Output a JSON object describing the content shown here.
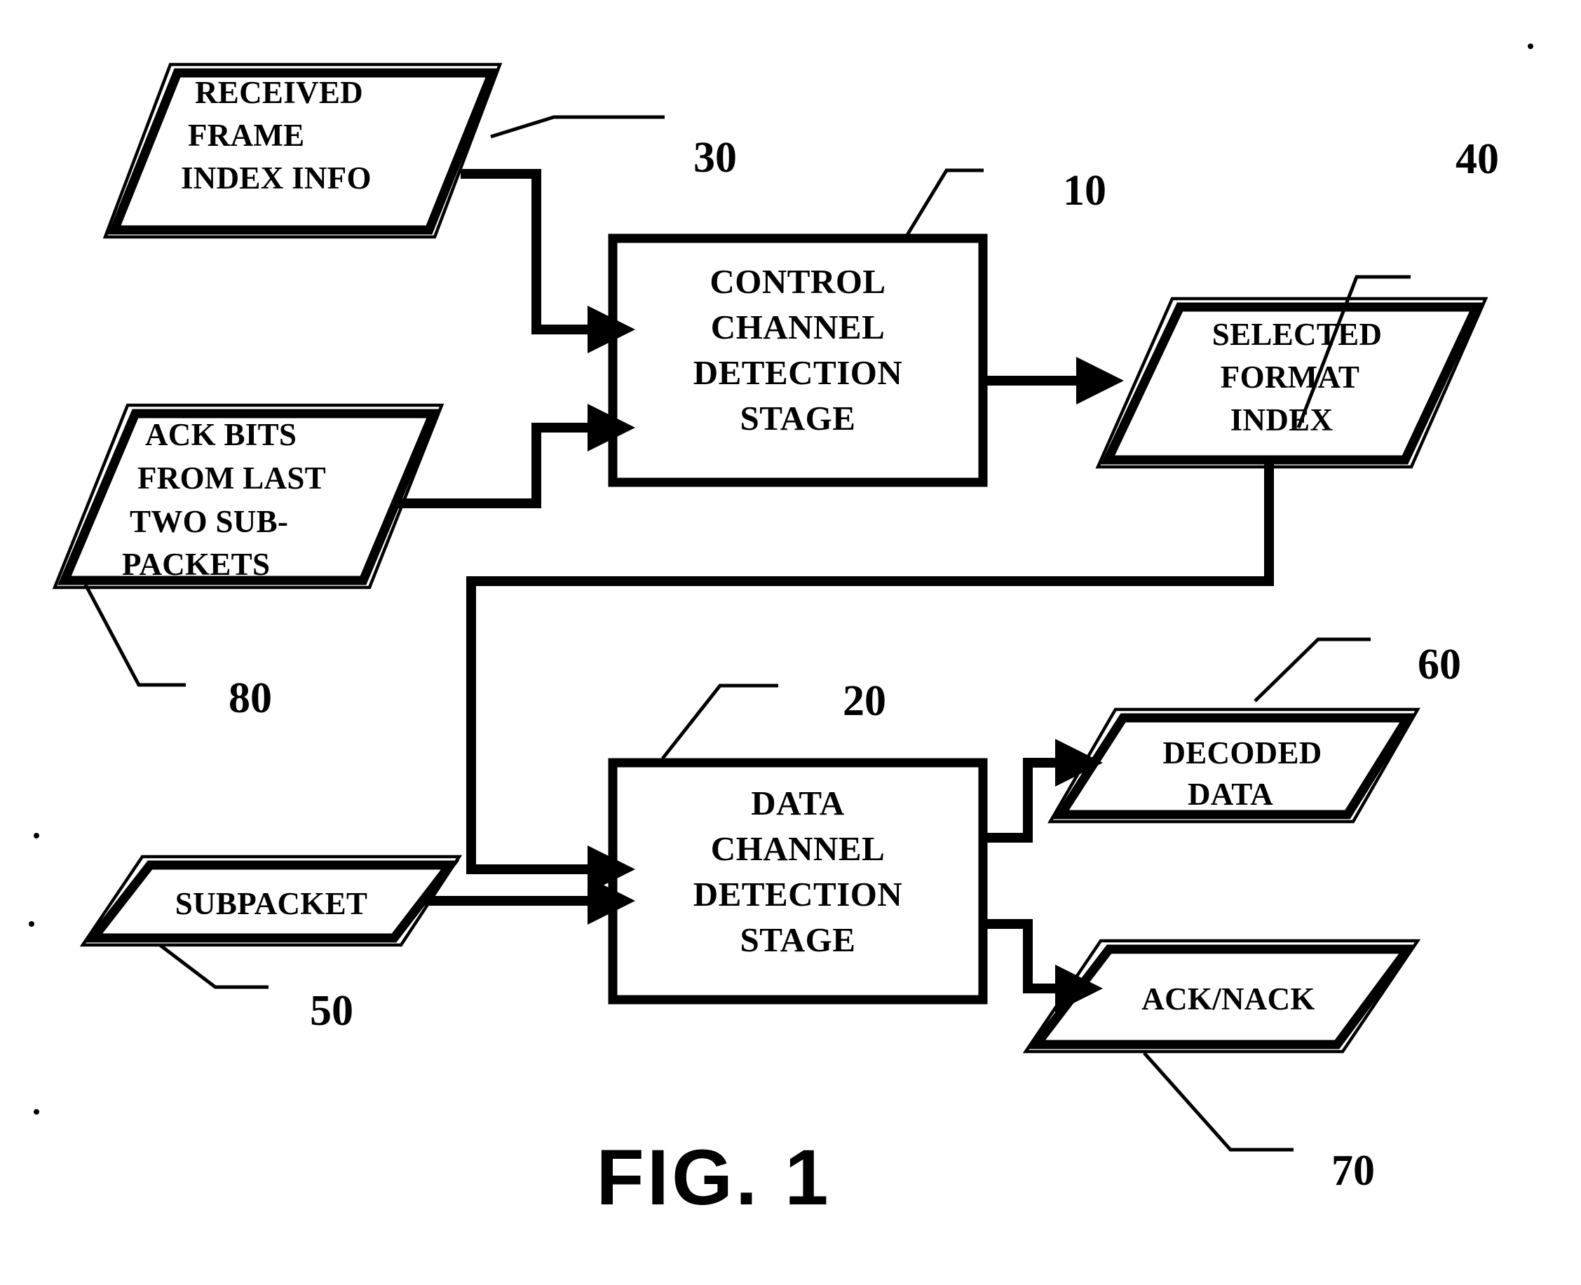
{
  "figure": {
    "caption": "FIG. 1",
    "title": "Control and data channel detection block diagram"
  },
  "nodes": {
    "received_frame_index_info": {
      "label_lines": [
        "RECEIVED",
        "FRAME",
        "INDEX INFO"
      ],
      "ref": "30",
      "shape": "parallelogram"
    },
    "ack_bits": {
      "label_lines": [
        "ACK BITS",
        "FROM LAST",
        "TWO SUB-",
        "PACKETS"
      ],
      "ref": "80",
      "shape": "parallelogram"
    },
    "control_channel_detection_stage": {
      "label_lines": [
        "CONTROL",
        "CHANNEL",
        "DETECTION",
        "STAGE"
      ],
      "ref": "10",
      "shape": "process-box"
    },
    "selected_format_index": {
      "label_lines": [
        "SELECTED",
        "FORMAT",
        "INDEX"
      ],
      "ref": "40",
      "shape": "parallelogram"
    },
    "data_channel_detection_stage": {
      "label_lines": [
        "DATA",
        "CHANNEL",
        "DETECTION",
        "STAGE"
      ],
      "ref": "20",
      "shape": "process-box"
    },
    "subpacket": {
      "label_lines": [
        "SUBPACKET"
      ],
      "ref": "50",
      "shape": "parallelogram"
    },
    "decoded_data": {
      "label_lines": [
        "DECODED",
        "DATA"
      ],
      "ref": "60",
      "shape": "parallelogram"
    },
    "ack_nack": {
      "label_lines": [
        "ACK/NACK"
      ],
      "ref": "70",
      "shape": "parallelogram"
    }
  },
  "reference_numerals": [
    {
      "id": "ref-30",
      "value": "30"
    },
    {
      "id": "ref-10",
      "value": "10"
    },
    {
      "id": "ref-40",
      "value": "40"
    },
    {
      "id": "ref-80",
      "value": "80"
    },
    {
      "id": "ref-60",
      "value": "60"
    },
    {
      "id": "ref-20",
      "value": "20"
    },
    {
      "id": "ref-50",
      "value": "50"
    },
    {
      "id": "ref-70",
      "value": "70"
    }
  ],
  "edges": [
    {
      "from": "received_frame_index_info",
      "to": "control_channel_detection_stage"
    },
    {
      "from": "ack_bits",
      "to": "control_channel_detection_stage"
    },
    {
      "from": "control_channel_detection_stage",
      "to": "selected_format_index"
    },
    {
      "from": "selected_format_index",
      "to": "data_channel_detection_stage"
    },
    {
      "from": "subpacket",
      "to": "data_channel_detection_stage"
    },
    {
      "from": "data_channel_detection_stage",
      "to": "decoded_data"
    },
    {
      "from": "data_channel_detection_stage",
      "to": "ack_nack"
    }
  ],
  "colors": {
    "ink": "#000000",
    "paper": "#ffffff"
  }
}
